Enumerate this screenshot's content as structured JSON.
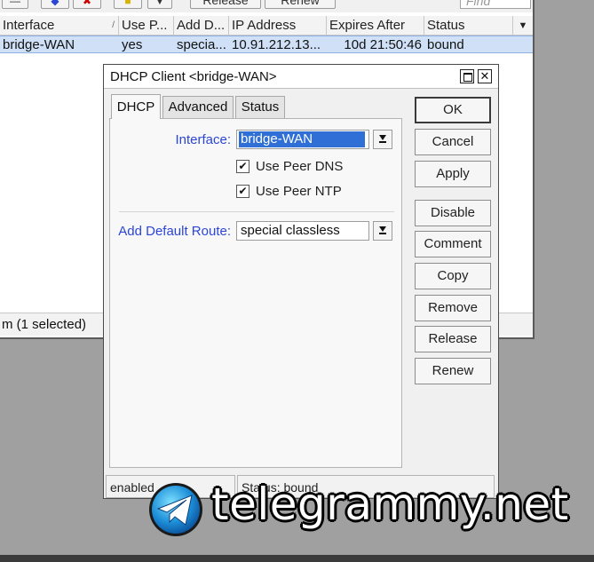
{
  "background_window": {
    "toolbar": {
      "release_label": "Release",
      "renew_label": "Renew",
      "find_placeholder": "Find"
    },
    "columns": [
      "Interface",
      "Use P...",
      "Add D...",
      "IP Address",
      "Expires After",
      "Status"
    ],
    "row": {
      "interface": "bridge-WAN",
      "use_peer": "yes",
      "add_default": "specia...",
      "ip_address": "10.91.212.13...",
      "expires_after": "10d 21:50:46",
      "status": "bound"
    },
    "status_text": "m (1 selected)"
  },
  "dialog": {
    "title": "DHCP Client <bridge-WAN>",
    "tabs": [
      "DHCP",
      "Advanced",
      "Status"
    ],
    "interface_label": "Interface:",
    "interface_value": "bridge-WAN",
    "use_peer_dns_label": "Use Peer DNS",
    "use_peer_dns_checked": true,
    "use_peer_ntp_label": "Use Peer NTP",
    "use_peer_ntp_checked": true,
    "add_default_route_label": "Add Default Route:",
    "add_default_route_value": "special classless",
    "buttons": [
      "OK",
      "Cancel",
      "Apply",
      "Disable",
      "Comment",
      "Copy",
      "Remove",
      "Release",
      "Renew"
    ],
    "status_left": "enabled",
    "status_right": "Status: bound"
  },
  "watermark": {
    "text": "telegrammy.net"
  },
  "colors": {
    "field_label": "#2b46d6",
    "selection": "#2f6fd6",
    "row_highlight": "#cfe0f7",
    "desktop": "#a0a0a0"
  }
}
